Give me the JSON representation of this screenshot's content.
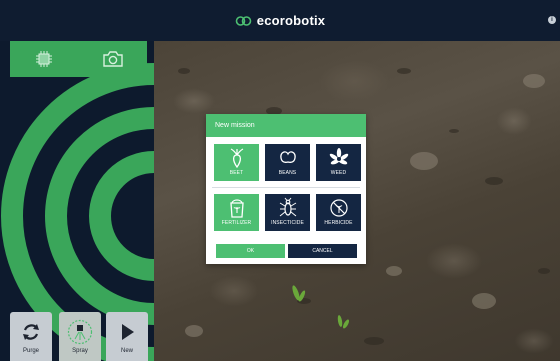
{
  "header": {
    "brand": "ecorobotix",
    "info_icon": "info-icon"
  },
  "camera_toggle": {
    "items": [
      {
        "icon": "chip-icon"
      },
      {
        "icon": "camera-icon"
      }
    ]
  },
  "controls": [
    {
      "label": "Purge",
      "icon": "refresh-icon"
    },
    {
      "label": "Spray",
      "icon": "spray-icon"
    },
    {
      "label": "New",
      "icon": "play-icon"
    }
  ],
  "modal": {
    "title": "New mission",
    "crops": [
      {
        "label": "BEET",
        "icon": "beet-icon",
        "selected": true
      },
      {
        "label": "BEANS",
        "icon": "beans-icon",
        "selected": false
      },
      {
        "label": "WEED",
        "icon": "weed-icon",
        "selected": false
      }
    ],
    "treatments": [
      {
        "label": "FERTILIZER",
        "icon": "fertilizer-icon",
        "selected": true
      },
      {
        "label": "INSECTICIDE",
        "icon": "insect-icon",
        "selected": false
      },
      {
        "label": "HERBICIDE",
        "icon": "herbicide-icon",
        "selected": false
      }
    ],
    "ok_label": "OK",
    "cancel_label": "CANCEL"
  },
  "colors": {
    "accent": "#4dbf72",
    "dark": "#142642",
    "background": "#0d1a2d"
  }
}
